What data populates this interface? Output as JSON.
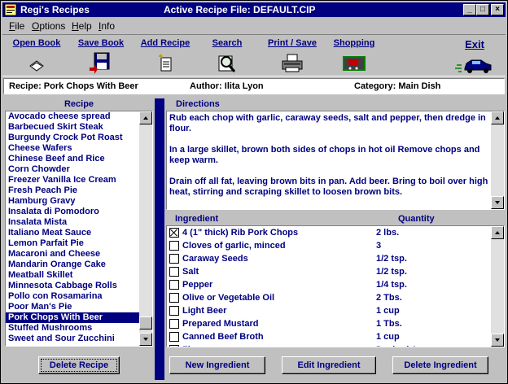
{
  "window": {
    "title": "Regi's Recipes",
    "active_file": "Active Recipe File:  DEFAULT.CIP",
    "min_glyph": "_",
    "max_glyph": "□",
    "close_glyph": "×"
  },
  "menu": [
    {
      "hot": "F",
      "rest": "ile"
    },
    {
      "hot": "O",
      "rest": "ptions"
    },
    {
      "hot": "H",
      "rest": "elp"
    },
    {
      "hot": "I",
      "rest": "nfo"
    }
  ],
  "toolbar": {
    "open": "Open Book",
    "save": "Save  Book",
    "add": "Add Recipe",
    "search": "Search",
    "print": "Print / Save",
    "shopping": "Shopping",
    "exit": "Exit"
  },
  "info": {
    "recipe": "Recipe:  Pork Chops With Beer",
    "author": "Author: Ilita Lyon",
    "category": "Category: Main Dish"
  },
  "recipes": {
    "header": "Recipe",
    "items": [
      "Avocado cheese spread",
      "Barbecued Skirt Steak",
      "Burgundy Crock Pot Roast",
      "Cheese Wafers",
      "Chinese Beef and Rice",
      "Corn Chowder",
      "Freezer Vanilla Ice Cream",
      "Fresh Peach Pie",
      "Hamburg Gravy",
      "Insalata di Pomodoro",
      "Insalata Mista",
      "Italiano Meat Sauce",
      "Lemon Parfait Pie",
      "Macaroni and Cheese",
      "Mandarin Orange Cake",
      "Meatball Skillet",
      "Minnesota Cabbage Rolls",
      "Pollo con Rosamarina",
      "Poor Man's Pie",
      "Pork Chops With Beer",
      "Stuffed Mushrooms",
      "Sweet and Sour Zucchini"
    ],
    "selected": "Pork Chops With Beer",
    "delete_button": "Delete Recipe"
  },
  "directions": {
    "header": "Directions",
    "paragraphs": [
      "Rub each chop with garlic, caraway seeds, salt and pepper, then dredge in flour.",
      "In a large skillet, brown both sides of chops in hot oil  Remove chops and keep warm.",
      "Drain off all fat, leaving brown bits in pan.  Add beer.  Bring to boil over high heat, stirring and scraping skillet to loosen brown bits."
    ]
  },
  "ingredients": {
    "col_ingredient": "Ingredient",
    "col_quantity": "Quantity",
    "rows": [
      {
        "name": "4 (1\" thick) Rib Pork Chops",
        "qty": "2 lbs.",
        "checked": true
      },
      {
        "name": "Cloves of garlic, minced",
        "qty": "3",
        "checked": false
      },
      {
        "name": "Caraway Seeds",
        "qty": "1/2 tsp.",
        "checked": false
      },
      {
        "name": "Salt",
        "qty": "1/2 tsp.",
        "checked": false
      },
      {
        "name": "Pepper",
        "qty": "1/4 tsp.",
        "checked": false
      },
      {
        "name": "Olive or Vegetable Oil",
        "qty": "2 Tbs.",
        "checked": false
      },
      {
        "name": "Light Beer",
        "qty": "1 cup",
        "checked": false
      },
      {
        "name": "Prepared Mustard",
        "qty": "1 Tbs.",
        "checked": false
      },
      {
        "name": "Canned Beef Broth",
        "qty": "1 cup",
        "checked": false
      },
      {
        "name": "Flour",
        "qty": "Desired Am",
        "checked": false
      }
    ],
    "new_button": "New Ingredient",
    "edit_button": "Edit Ingredient",
    "delete_button": "Delete Ingredient"
  },
  "icons": {
    "open": "open-book-icon",
    "save": "save-floppy-icon",
    "add": "add-recipe-icon",
    "search": "magnifier-icon",
    "print": "printer-icon",
    "shopping": "shopping-cart-icon",
    "exit": "car-icon"
  }
}
